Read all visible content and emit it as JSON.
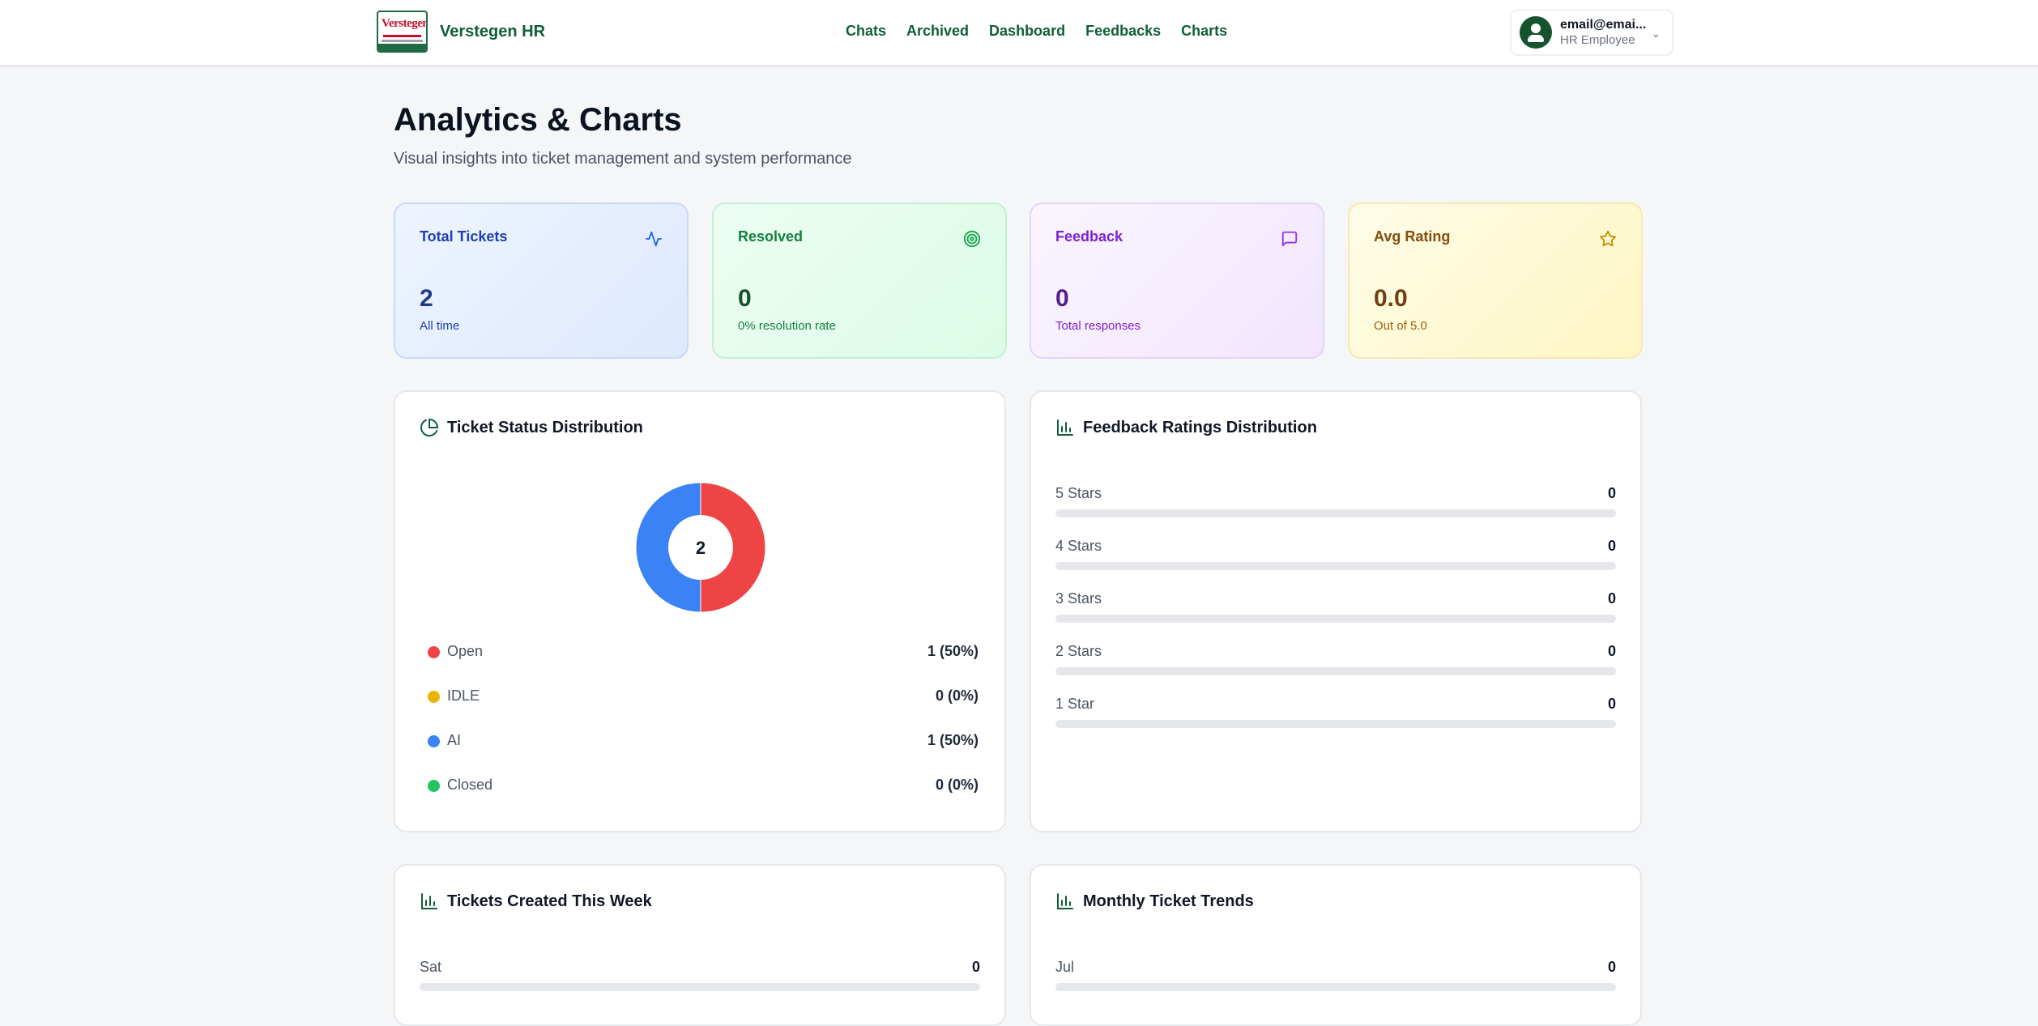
{
  "header": {
    "logo_text": "Verstegen",
    "brand": "Verstegen HR",
    "nav": [
      "Chats",
      "Archived",
      "Dashboard",
      "Feedbacks",
      "Charts"
    ],
    "user_email": "email@emai...",
    "user_role": "HR Employee"
  },
  "page": {
    "title": "Analytics & Charts",
    "subtitle": "Visual insights into ticket management and system performance"
  },
  "stats": [
    {
      "label": "Total Tickets",
      "value": "2",
      "note": "All time",
      "icon": "activity-icon"
    },
    {
      "label": "Resolved",
      "value": "0",
      "note": "0% resolution rate",
      "icon": "target-icon"
    },
    {
      "label": "Feedback",
      "value": "0",
      "note": "Total responses",
      "icon": "message-square-icon"
    },
    {
      "label": "Avg Rating",
      "value": "0.0",
      "note": "Out of 5.0",
      "icon": "star-icon"
    }
  ],
  "status_card": {
    "title": "Ticket Status Distribution",
    "total": "2",
    "legend": [
      {
        "label": "Open",
        "value": "1 (50%)",
        "color": "#ef4444"
      },
      {
        "label": "IDLE",
        "value": "0 (0%)",
        "color": "#eab308"
      },
      {
        "label": "AI",
        "value": "1 (50%)",
        "color": "#3b82f6"
      },
      {
        "label": "Closed",
        "value": "0 (0%)",
        "color": "#22c55e"
      }
    ]
  },
  "ratings_card": {
    "title": "Feedback Ratings Distribution",
    "rows": [
      {
        "label": "5 Stars",
        "value": "0"
      },
      {
        "label": "4 Stars",
        "value": "0"
      },
      {
        "label": "3 Stars",
        "value": "0"
      },
      {
        "label": "2 Stars",
        "value": "0"
      },
      {
        "label": "1 Star",
        "value": "0"
      }
    ]
  },
  "week_card": {
    "title": "Tickets Created This Week",
    "rows": [
      {
        "label": "Sat",
        "value": "0"
      }
    ]
  },
  "month_card": {
    "title": "Monthly Ticket Trends",
    "rows": [
      {
        "label": "Jul",
        "value": "0"
      }
    ]
  },
  "chart_data": {
    "type": "pie",
    "categories": [
      "Open",
      "IDLE",
      "AI",
      "Closed"
    ],
    "values": [
      1,
      0,
      1,
      0
    ],
    "center_label": "2"
  }
}
